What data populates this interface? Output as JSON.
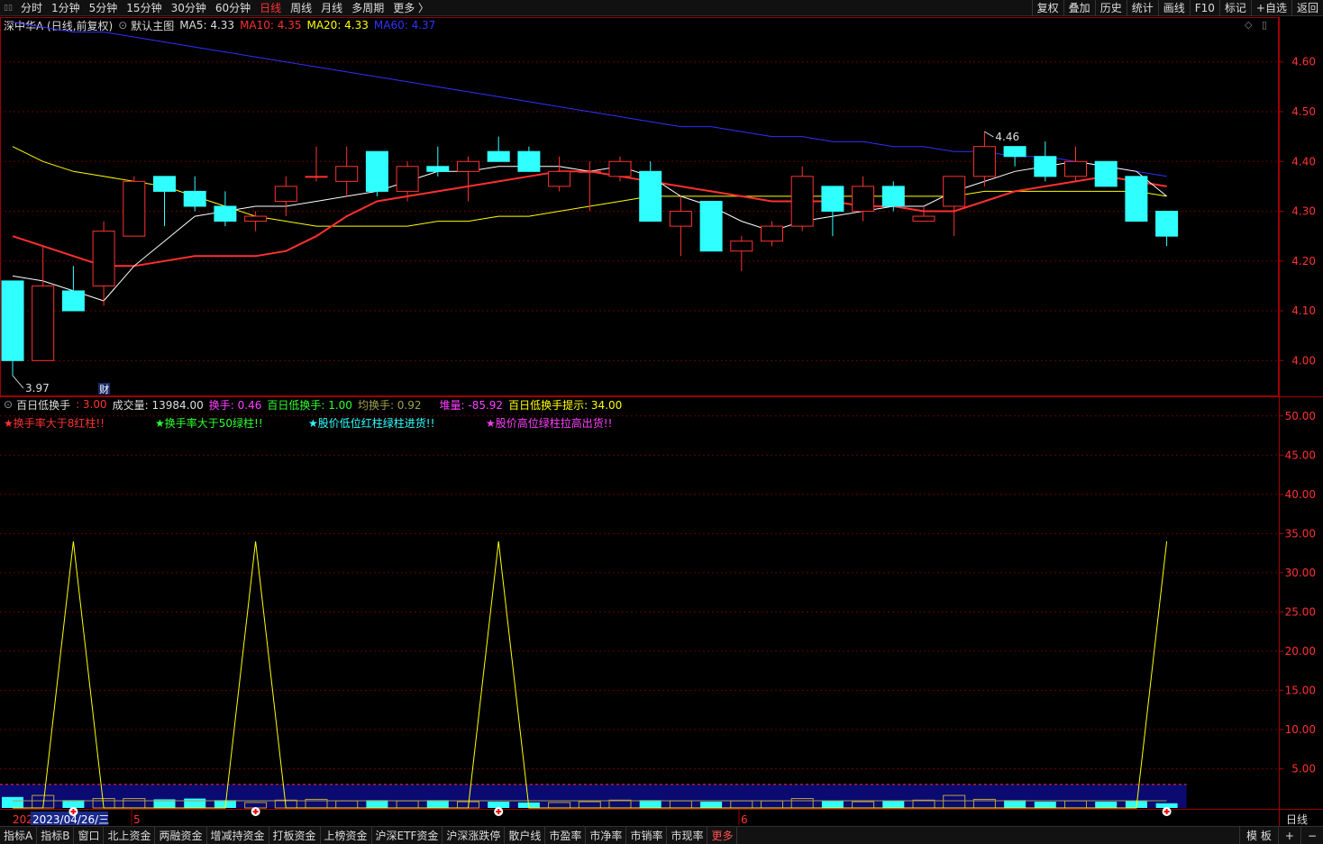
{
  "toolbar": {
    "periods": [
      "分时",
      "1分钟",
      "5分钟",
      "15分钟",
      "30分钟",
      "60分钟",
      "日线",
      "周线",
      "月线",
      "多周期",
      "更多 〉"
    ],
    "active_period": "日线",
    "right_buttons": [
      "复权",
      "叠加",
      "历史",
      "统计",
      "画线",
      "F10",
      "标记",
      "+自选",
      "返回"
    ]
  },
  "main_legend": {
    "stock_name": "深中华A (日线,前复权)",
    "template": "默认主图",
    "ma5": "MA5: 4.33",
    "ma10": "MA10: 4.35",
    "ma20": "MA20: 4.33",
    "ma60": "MA60: 4.37",
    "color_ma5": "#ffffff",
    "color_ma10": "#ff3030",
    "color_ma20": "#ffff00",
    "color_ma60": "#3030ff"
  },
  "price_axis": [
    "4.60",
    "4.50",
    "4.40",
    "4.30",
    "4.20",
    "4.10",
    "4.00"
  ],
  "annotations": {
    "high_label": "4.46",
    "low_label": "3.97",
    "finance_mark": "财"
  },
  "sub_legend": {
    "name": "百日低换手",
    "value_main": ": 3.00",
    "volume": "成交量: 13984.00",
    "turnover": "换手: 0.46",
    "low100": "百日低换手: 1.00",
    "avg_turnover": "均换手: 0.92",
    "pile": "堆量: -85.92",
    "hint": "百日低换手提示: 34.00"
  },
  "sub_notes": [
    "★换手率大于8红柱!!",
    "★换手率大于50绿柱!!",
    "★股价低位红柱绿柱进货!!",
    "★股价高位绿柱拉高出货!!"
  ],
  "sub_axis": [
    "50.00",
    "45.00",
    "40.00",
    "35.00",
    "30.00",
    "25.00",
    "20.00",
    "15.00",
    "10.00",
    "5.00"
  ],
  "date_axis": {
    "year_prefix": "202",
    "cursor_date": "2023/04/26/三",
    "month_5": "5",
    "month_6": "6",
    "period_label": "日线"
  },
  "bottom_tabs": [
    "指标A",
    "指标B",
    "窗口",
    "北上资金",
    "两融资金",
    "增减持资金",
    "打板资金",
    "上榜资金",
    "沪深ETF资金",
    "沪深涨跌停",
    "散户线",
    "市盈率",
    "市净率",
    "市销率",
    "市现率",
    "更多"
  ],
  "bottom_right": [
    "模 板",
    "+",
    "−"
  ],
  "chart_data": {
    "type": "candlestick",
    "ylim": [
      3.93,
      4.69
    ],
    "candles": [
      {
        "o": 4.16,
        "h": 4.16,
        "l": 3.97,
        "c": 4.0
      },
      {
        "o": 4.0,
        "h": 4.23,
        "l": 4.0,
        "c": 4.15
      },
      {
        "o": 4.14,
        "h": 4.19,
        "l": 4.1,
        "c": 4.1
      },
      {
        "o": 4.15,
        "h": 4.28,
        "l": 4.11,
        "c": 4.26
      },
      {
        "o": 4.25,
        "h": 4.37,
        "l": 4.25,
        "c": 4.36
      },
      {
        "o": 4.37,
        "h": 4.37,
        "l": 4.27,
        "c": 4.34
      },
      {
        "o": 4.34,
        "h": 4.37,
        "l": 4.3,
        "c": 4.31
      },
      {
        "o": 4.31,
        "h": 4.34,
        "l": 4.27,
        "c": 4.28
      },
      {
        "o": 4.28,
        "h": 4.3,
        "l": 4.26,
        "c": 4.29
      },
      {
        "o": 4.32,
        "h": 4.37,
        "l": 4.29,
        "c": 4.35
      },
      {
        "o": 4.37,
        "h": 4.43,
        "l": 4.36,
        "c": 4.37
      },
      {
        "o": 4.36,
        "h": 4.43,
        "l": 4.33,
        "c": 4.39
      },
      {
        "o": 4.42,
        "h": 4.42,
        "l": 4.33,
        "c": 4.34
      },
      {
        "o": 4.34,
        "h": 4.4,
        "l": 4.32,
        "c": 4.39
      },
      {
        "o": 4.39,
        "h": 4.43,
        "l": 4.37,
        "c": 4.38
      },
      {
        "o": 4.38,
        "h": 4.41,
        "l": 4.32,
        "c": 4.4
      },
      {
        "o": 4.42,
        "h": 4.45,
        "l": 4.4,
        "c": 4.4
      },
      {
        "o": 4.42,
        "h": 4.43,
        "l": 4.38,
        "c": 4.38
      },
      {
        "o": 4.35,
        "h": 4.41,
        "l": 4.34,
        "c": 4.38
      },
      {
        "o": 4.38,
        "h": 4.4,
        "l": 4.3,
        "c": 4.38
      },
      {
        "o": 4.37,
        "h": 4.41,
        "l": 4.36,
        "c": 4.4
      },
      {
        "o": 4.38,
        "h": 4.4,
        "l": 4.28,
        "c": 4.28
      },
      {
        "o": 4.27,
        "h": 4.33,
        "l": 4.21,
        "c": 4.3
      },
      {
        "o": 4.32,
        "h": 4.32,
        "l": 4.22,
        "c": 4.22
      },
      {
        "o": 4.22,
        "h": 4.25,
        "l": 4.18,
        "c": 4.24
      },
      {
        "o": 4.24,
        "h": 4.28,
        "l": 4.23,
        "c": 4.27
      },
      {
        "o": 4.27,
        "h": 4.39,
        "l": 4.26,
        "c": 4.37
      },
      {
        "o": 4.35,
        "h": 4.35,
        "l": 4.25,
        "c": 4.3
      },
      {
        "o": 4.3,
        "h": 4.37,
        "l": 4.28,
        "c": 4.35
      },
      {
        "o": 4.35,
        "h": 4.36,
        "l": 4.3,
        "c": 4.31
      },
      {
        "o": 4.28,
        "h": 4.31,
        "l": 4.28,
        "c": 4.29
      },
      {
        "o": 4.31,
        "h": 4.37,
        "l": 4.25,
        "c": 4.37
      },
      {
        "o": 4.37,
        "h": 4.46,
        "l": 4.35,
        "c": 4.43
      },
      {
        "o": 4.43,
        "h": 4.43,
        "l": 4.39,
        "c": 4.41
      },
      {
        "o": 4.41,
        "h": 4.44,
        "l": 4.36,
        "c": 4.37
      },
      {
        "o": 4.37,
        "h": 4.43,
        "l": 4.36,
        "c": 4.4
      },
      {
        "o": 4.4,
        "h": 4.4,
        "l": 4.35,
        "c": 4.35
      },
      {
        "o": 4.37,
        "h": 4.37,
        "l": 4.28,
        "c": 4.28
      },
      {
        "o": 4.3,
        "h": 4.3,
        "l": 4.23,
        "c": 4.25
      }
    ],
    "ma5": [
      4.17,
      4.16,
      4.14,
      4.12,
      4.19,
      4.24,
      4.29,
      4.3,
      4.31,
      4.31,
      4.32,
      4.33,
      4.34,
      4.36,
      4.38,
      4.38,
      4.39,
      4.39,
      4.39,
      4.38,
      4.39,
      4.37,
      4.33,
      4.31,
      4.28,
      4.26,
      4.28,
      4.29,
      4.3,
      4.31,
      4.31,
      4.34,
      4.36,
      4.38,
      4.39,
      4.4,
      4.39,
      4.38,
      4.33
    ],
    "ma10": [
      4.25,
      4.23,
      4.21,
      4.19,
      4.19,
      4.2,
      4.21,
      4.21,
      4.21,
      4.22,
      4.25,
      4.29,
      4.32,
      4.33,
      4.34,
      4.35,
      4.36,
      4.37,
      4.38,
      4.38,
      4.37,
      4.36,
      4.35,
      4.34,
      4.33,
      4.32,
      4.32,
      4.32,
      4.31,
      4.31,
      4.3,
      4.3,
      4.32,
      4.34,
      4.35,
      4.36,
      4.37,
      4.36,
      4.35
    ],
    "ma20": [
      4.43,
      4.4,
      4.38,
      4.37,
      4.36,
      4.35,
      4.33,
      4.31,
      4.29,
      4.28,
      4.27,
      4.27,
      4.27,
      4.27,
      4.28,
      4.28,
      4.29,
      4.29,
      4.3,
      4.31,
      4.32,
      4.33,
      4.33,
      4.33,
      4.33,
      4.33,
      4.33,
      4.33,
      4.33,
      4.33,
      4.33,
      4.33,
      4.34,
      4.34,
      4.34,
      4.34,
      4.34,
      4.34,
      4.33
    ],
    "ma60": [
      4.68,
      4.67,
      4.66,
      4.66,
      4.65,
      4.64,
      4.63,
      4.62,
      4.61,
      4.6,
      4.59,
      4.58,
      4.57,
      4.56,
      4.55,
      4.54,
      4.53,
      4.52,
      4.51,
      4.5,
      4.49,
      4.48,
      4.47,
      4.47,
      4.46,
      4.45,
      4.45,
      4.44,
      4.44,
      4.43,
      4.43,
      4.42,
      4.42,
      4.41,
      4.41,
      4.4,
      4.39,
      4.38,
      4.37
    ],
    "sub_ylim": [
      0,
      52.5
    ],
    "hint_line": [
      0,
      0,
      34,
      0,
      0,
      0,
      0,
      0,
      34,
      0,
      0,
      0,
      0,
      0,
      0,
      0,
      34,
      0,
      0,
      0,
      0,
      0,
      0,
      0,
      0,
      0,
      0,
      0,
      0,
      0,
      0,
      0,
      0,
      0,
      0,
      0,
      0,
      0,
      34
    ],
    "turnover_bars": [
      1.4,
      1.6,
      1.0,
      1.2,
      1.2,
      1.1,
      1.2,
      1.0,
      0.7,
      1.0,
      1.1,
      0.9,
      1.0,
      0.9,
      1.0,
      0.8,
      0.8,
      0.7,
      0.7,
      0.8,
      1.0,
      1.0,
      0.9,
      0.8,
      0.9,
      0.9,
      1.2,
      0.9,
      0.8,
      0.9,
      1.0,
      1.6,
      1.1,
      1.0,
      0.8,
      0.9,
      0.8,
      0.9,
      0.6
    ]
  }
}
